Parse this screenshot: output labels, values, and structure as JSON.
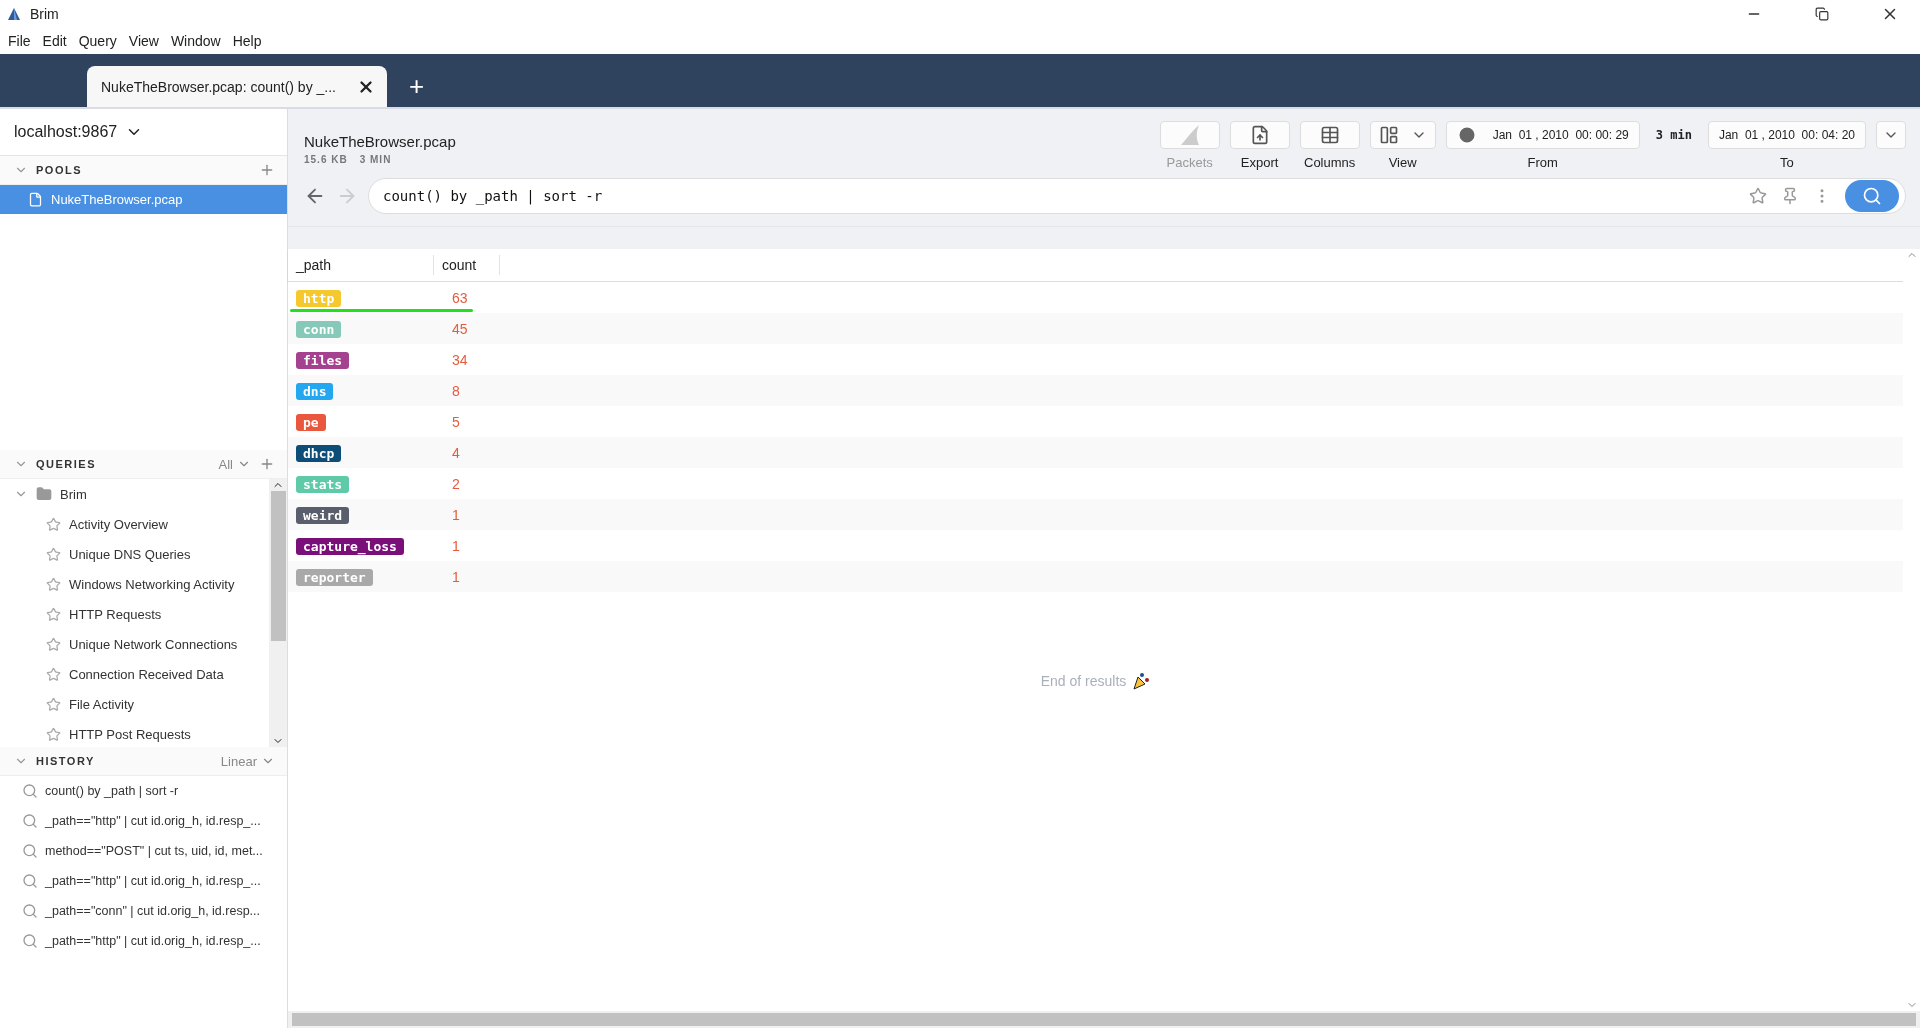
{
  "window": {
    "title": "Brim"
  },
  "menu": [
    "File",
    "Edit",
    "Query",
    "View",
    "Window",
    "Help"
  ],
  "tabs": [
    {
      "label": "NukeTheBrowser.pcap: count() by _...",
      "selected": true
    }
  ],
  "new_tab": "+",
  "sidebar": {
    "lake": "localhost:9867",
    "pools": {
      "title": "POOLS",
      "expanded": true,
      "items": [
        {
          "name": "NukeTheBrowser.pcap",
          "selected": true
        }
      ]
    },
    "queries": {
      "title": "QUERIES",
      "expanded": true,
      "filter": "All",
      "folders": [
        {
          "name": "Brim",
          "expanded": true,
          "children": [
            {
              "name": "Activity Overview"
            },
            {
              "name": "Unique DNS Queries"
            },
            {
              "name": "Windows Networking Activity"
            },
            {
              "name": "HTTP Requests"
            },
            {
              "name": "Unique Network Connections"
            },
            {
              "name": "Connection Received Data"
            },
            {
              "name": "File Activity"
            },
            {
              "name": "HTTP Post Requests"
            }
          ]
        }
      ]
    },
    "history": {
      "title": "HISTORY",
      "expanded": true,
      "mode": "Linear",
      "items": [
        "count() by _path | sort -r",
        "_path==\"http\" | cut id.orig_h, id.resp_...",
        "method==\"POST\" | cut ts, uid, id, met...",
        "_path==\"http\" | cut id.orig_h, id.resp_...",
        "_path==\"conn\" | cut id.orig_h, id.resp...",
        "_path==\"http\" | cut id.orig_h, id.resp_..."
      ]
    }
  },
  "header": {
    "title": "NukeTheBrowser.pcap",
    "size": "15.6 KB",
    "span": "3 MIN",
    "tools": [
      {
        "kind": "packets",
        "label": "Packets",
        "disabled": true
      },
      {
        "kind": "export",
        "label": "Export",
        "disabled": false
      },
      {
        "kind": "columns",
        "label": "Columns",
        "disabled": false
      },
      {
        "kind": "view",
        "label": "View",
        "disabled": false
      }
    ],
    "from": {
      "label": "From",
      "value": "Jan  01 , 2010  00: 00: 29"
    },
    "duration": "3 min",
    "to": {
      "label": "To",
      "value": "Jan  01 , 2010  00: 04: 20"
    }
  },
  "search": {
    "value": "count() by _path | sort -r",
    "back_enabled": true,
    "forward_enabled": false
  },
  "table": {
    "columns": [
      "_path",
      "count"
    ],
    "rows": [
      {
        "path": "http",
        "color": "#f5c82d",
        "count": "63",
        "selected": true
      },
      {
        "path": "conn",
        "color": "#86c9b8",
        "count": "45",
        "selected": false
      },
      {
        "path": "files",
        "color": "#a5428f",
        "count": "34",
        "selected": false
      },
      {
        "path": "dns",
        "color": "#22a7f0",
        "count": "8",
        "selected": false
      },
      {
        "path": "pe",
        "color": "#e9573c",
        "count": "5",
        "selected": false
      },
      {
        "path": "dhcp",
        "color": "#0d4e78",
        "count": "4",
        "selected": false
      },
      {
        "path": "stats",
        "color": "#5ecaa7",
        "count": "2",
        "selected": false
      },
      {
        "path": "weird",
        "color": "#5a5d6b",
        "count": "1",
        "selected": false
      },
      {
        "path": "capture_loss",
        "color": "#7a0f79",
        "count": "1",
        "selected": false
      },
      {
        "path": "reporter",
        "color": "#a9a9a9",
        "count": "1",
        "selected": false
      }
    ]
  },
  "end_text": "End of results"
}
